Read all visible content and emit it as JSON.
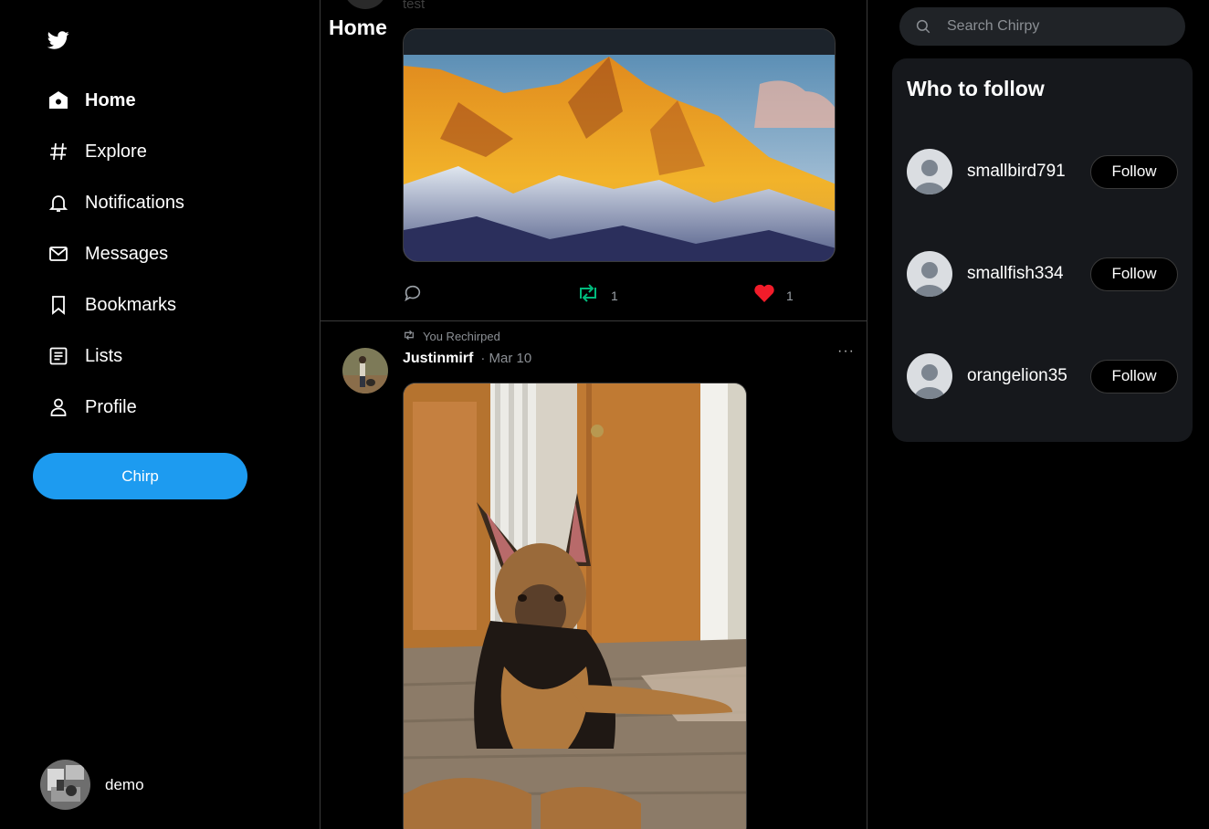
{
  "sidebar": {
    "logo_icon": "bird-icon",
    "nav": [
      {
        "label": "Home",
        "icon": "home-icon",
        "active": true
      },
      {
        "label": "Explore",
        "icon": "hashtag-icon"
      },
      {
        "label": "Notifications",
        "icon": "bell-icon"
      },
      {
        "label": "Messages",
        "icon": "envelope-icon"
      },
      {
        "label": "Bookmarks",
        "icon": "bookmark-icon"
      },
      {
        "label": "Lists",
        "icon": "list-icon"
      },
      {
        "label": "Profile",
        "icon": "person-icon"
      }
    ],
    "chirp_label": "Chirp",
    "account_name": "demo"
  },
  "feed": {
    "title": "Home",
    "post1": {
      "text": "test",
      "retweet_count": "1",
      "like_count": "1"
    },
    "post2": {
      "rechirp_label": "You Rechirped",
      "username": "Justinmirf",
      "date": "· Mar 10",
      "more": "···"
    }
  },
  "right": {
    "search_placeholder": "Search Chirpy",
    "who_to_follow_title": "Who to follow",
    "suggestions": [
      {
        "username": "smallbird791",
        "button": "Follow"
      },
      {
        "username": "smallfish334",
        "button": "Follow"
      },
      {
        "username": "orangelion35",
        "button": "Follow"
      }
    ]
  },
  "colors": {
    "accent": "#1d9bf0",
    "retweet_active": "#00ba7c",
    "like_active": "#f91880"
  }
}
